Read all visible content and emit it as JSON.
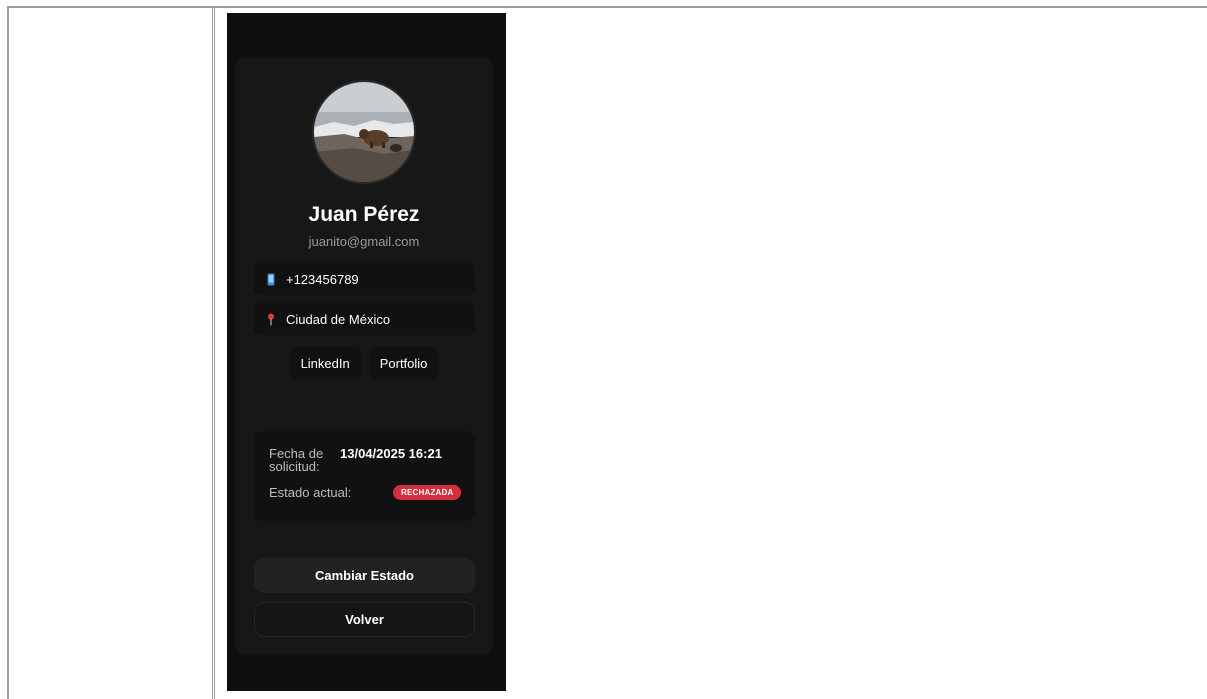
{
  "profile": {
    "name": "Juan Pérez",
    "email": "juanito@gmail.com",
    "phone": "+123456789",
    "location": "Ciudad de México",
    "links": [
      {
        "label": "LinkedIn"
      },
      {
        "label": "Portfolio"
      }
    ]
  },
  "application": {
    "date_label": "Fecha de solicitud:",
    "date_value": "13/04/2025 16:21",
    "state_label": "Estado actual:",
    "state_value": "RECHAZADA"
  },
  "actions": {
    "change_state": "Cambiar Estado",
    "back": "Volver"
  },
  "icons": {
    "phone": "mobile-phone-icon",
    "location": "location-pin-icon"
  },
  "colors": {
    "badge_rejected": "#d32f3f",
    "panel_bg": "#0f0f0f",
    "card_bg": "#171717",
    "location_pin": "#e53935",
    "phone_icon": "#3d8bd4"
  }
}
